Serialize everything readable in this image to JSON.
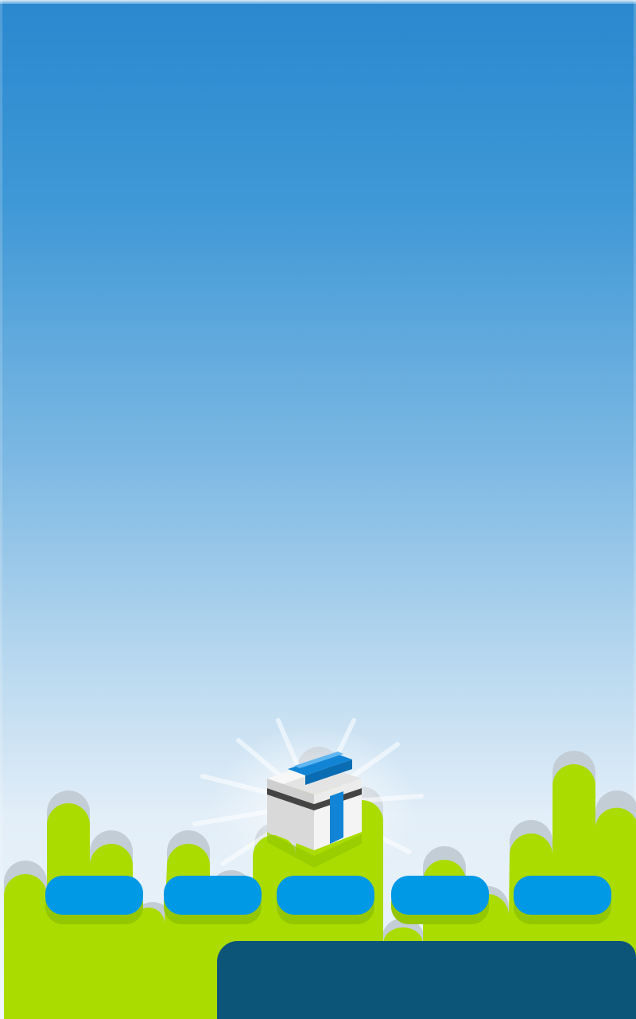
{
  "game": {
    "colors": {
      "sky_top": "#2a88cf",
      "sky_bottom": "#eef5fb",
      "grass": "#aadc00",
      "grass_shadow": "#93c700",
      "shadow_bumps": "#c3cdd6",
      "slot_button": "#0099e6",
      "bottom_panel": "#0d5479",
      "cube_white": "#eeeeee",
      "cube_stripe": "#1284d6"
    },
    "icons": [
      "gift-cube-icon"
    ],
    "slots": [
      {
        "label": ""
      },
      {
        "label": ""
      },
      {
        "label": ""
      },
      {
        "label": ""
      },
      {
        "label": ""
      }
    ],
    "bottom_panel": {
      "text": ""
    }
  }
}
